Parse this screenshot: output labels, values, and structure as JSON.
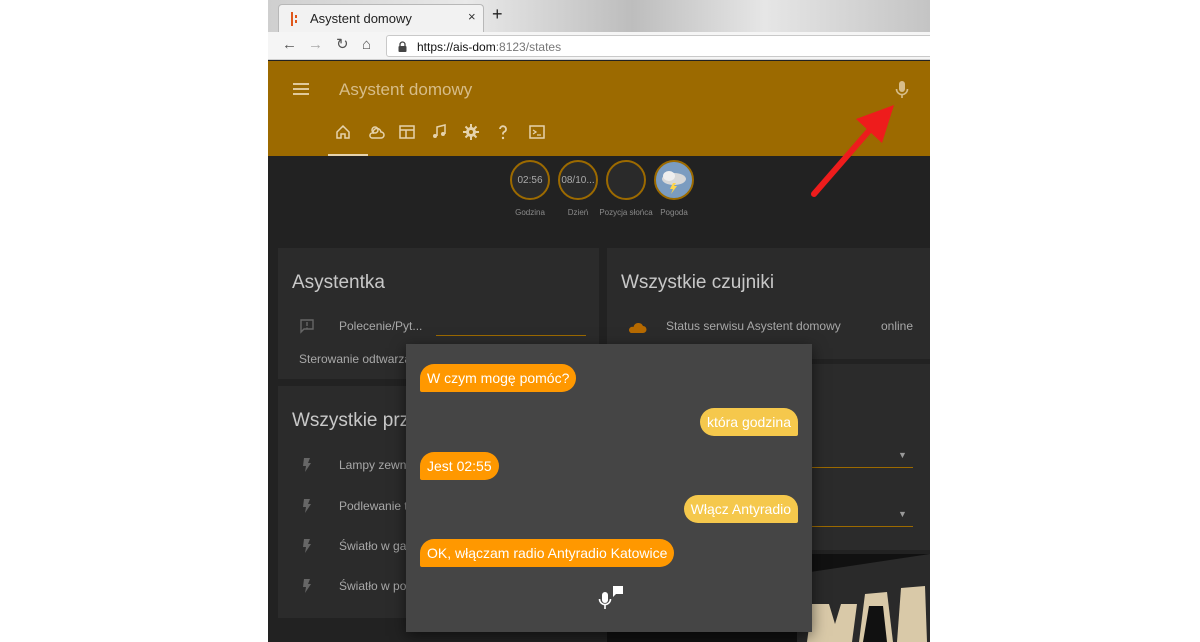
{
  "browser": {
    "tab_title": "Asystent domowy",
    "tab_close": "×",
    "new_tab": "+",
    "url_host": "https://ais-dom",
    "url_rest": ":8123/states"
  },
  "header": {
    "title": "Asystent domowy",
    "tabs": [
      "home",
      "weather",
      "dashboard",
      "music",
      "settings",
      "help",
      "terminal"
    ],
    "accent_color": "#9c6a00"
  },
  "badges": [
    {
      "value": "02:56",
      "label": "Godzina"
    },
    {
      "value": "08/10...",
      "label": "Dzień"
    },
    {
      "value": "",
      "label": "Pozycja słońca"
    },
    {
      "value": "",
      "label": "Pogoda"
    }
  ],
  "cards": {
    "asystentka": {
      "title": "Asystentka",
      "input_label": "Polecenie/Pyt...",
      "sub": "Sterowanie odtwarza"
    },
    "czujniki": {
      "title": "Wszystkie czujniki",
      "row_label": "Status serwisu Asystent domowy",
      "row_value": "online"
    },
    "przelaczniki": {
      "title": "Wszystkie prz",
      "items": [
        "Lampy zewn",
        "Podlewanie t",
        "Światło w ga",
        "Światło w po"
      ]
    }
  },
  "dialog": {
    "messages": [
      {
        "from": "bot",
        "text": "W czym mogę pomóc?"
      },
      {
        "from": "user",
        "text": "która godzina"
      },
      {
        "from": "bot",
        "text": "Jest 02:55"
      },
      {
        "from": "user",
        "text": "Włącz Antyradio"
      },
      {
        "from": "bot",
        "text": "OK, włączam radio Antyradio Katowice"
      }
    ],
    "bot_color": "#ff9800",
    "user_color": "#f5c84c"
  }
}
